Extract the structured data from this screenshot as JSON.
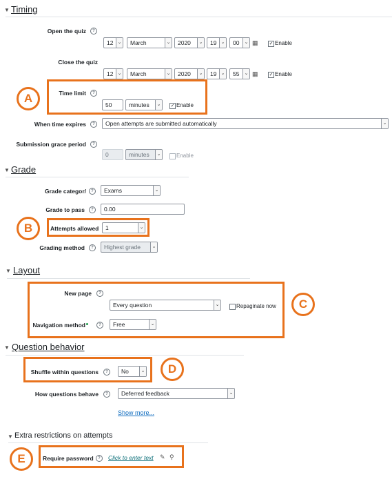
{
  "timing": {
    "title": "Timing",
    "open_label": "Open the quiz",
    "open": {
      "day": "12",
      "month": "March",
      "year": "2020",
      "hour": "19",
      "minute": "00"
    },
    "close_label": "Close the quiz",
    "close": {
      "day": "12",
      "month": "March",
      "year": "2020",
      "hour": "19",
      "minute": "55"
    },
    "enable_label": "Enable",
    "time_limit_label": "Time limit",
    "time_limit_value": "50",
    "time_limit_unit": "minutes",
    "expires_label": "When time expires",
    "expires_value": "Open attempts are submitted automatically",
    "grace_label": "Submission grace period",
    "grace_value": "0",
    "grace_unit": "minutes"
  },
  "grade": {
    "title": "Grade",
    "category_label": "Grade categor/",
    "category_value": "Exams",
    "pass_label": "Grade to pass",
    "pass_value": "0.00",
    "attempts_label": "Attempts allowed",
    "attempts_value": "1",
    "method_label": "Grading method",
    "method_value": "Highest grade"
  },
  "layout": {
    "title": "Layout",
    "new_page_label": "New page",
    "new_page_value": "Every question",
    "repaginate_label": "Repaginate now",
    "nav_label": "Navigation method",
    "nav_value": "Free"
  },
  "behavior": {
    "title": "Question behavior",
    "shuffle_label": "Shuffle within questions",
    "shuffle_value": "No",
    "how_label": "How questions behave",
    "how_value": "Deferred feedback",
    "show_more": "Show more..."
  },
  "extra": {
    "title": "Extra restrictions on attempts",
    "password_label": "Require password",
    "password_link": "Click to enter text"
  },
  "badges": {
    "a": "A",
    "b": "B",
    "c": "C",
    "d": "D",
    "e": "E"
  },
  "colors": {
    "highlight": "#e8721c",
    "link": "#0f6cbf"
  }
}
